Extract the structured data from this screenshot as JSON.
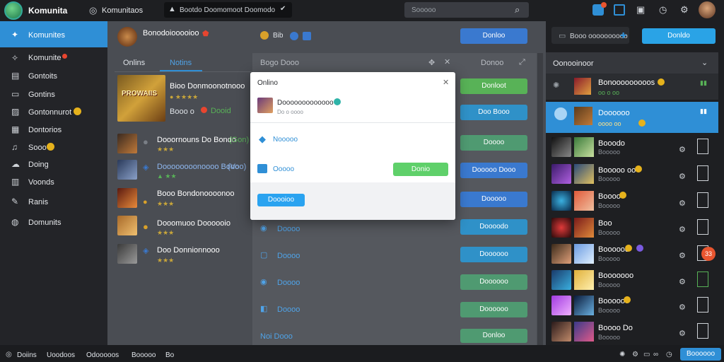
{
  "topbar": {
    "brand": "Komunita",
    "nav_label": "Komunitaos",
    "tab_text": "Bootdo Doomomoot Doomodo",
    "search_placeholder": "Sooooo"
  },
  "sidebar": {
    "items": [
      {
        "label": "Komunites",
        "icon": "globe-icon"
      },
      {
        "label": "Komunite",
        "icon": "star-icon"
      },
      {
        "label": "Gontoits",
        "icon": "grid-icon"
      },
      {
        "label": "Gontins",
        "icon": "chat-icon"
      },
      {
        "label": "Gontonnurot",
        "icon": "image-icon"
      },
      {
        "label": "Dontorios",
        "icon": "chart-icon"
      },
      {
        "label": "Sooo",
        "icon": "music-icon"
      },
      {
        "label": "Doing",
        "icon": "cloud-icon"
      },
      {
        "label": "Voonds",
        "icon": "book-icon"
      },
      {
        "label": "Ranis",
        "icon": "pencil-icon"
      },
      {
        "label": "Domunits",
        "icon": "world-icon"
      }
    ]
  },
  "main": {
    "header_title": "Bonodoiooooioo",
    "header_badge": "Bib",
    "header_button": "Donloo",
    "tabs": [
      "Onlins",
      "Notins"
    ],
    "panel_title": "Bogo Dooo",
    "col_label": "Donoo",
    "featured": {
      "title": "Bioo Donmoonotnooo",
      "sub": "Booo o",
      "tag": "Dooid",
      "logo_text": "PROWAIIS"
    },
    "rows": [
      {
        "title": "Dooornouns Do Bondo",
        "tag": "(Gon)"
      },
      {
        "title": "Doooooooonoooo Bono",
        "tag": "(Voo)"
      },
      {
        "title": "Booo Bondonoooonoo"
      },
      {
        "title": "Dooomuoo Doooooio"
      },
      {
        "title": "Doo Donnionnooo"
      }
    ],
    "right_buttons": [
      "Donloo",
      "Donloot",
      "Doo Booo",
      "Doooo",
      "Dooooo Dooo",
      "Dooooo",
      "Doooodo",
      "Doooooo",
      "Doooooo",
      "Doooooo"
    ],
    "under_modal": [
      {
        "label": "Doooo",
        "icon": "twitter-icon"
      },
      {
        "label": "Doooo",
        "icon": "grid-icon"
      },
      {
        "label": "Doooo",
        "icon": "circle-icon"
      },
      {
        "label": "Doooo",
        "icon": "box-icon"
      },
      {
        "label": "Noi Dooo",
        "icon": ""
      }
    ]
  },
  "modal": {
    "title": "Onlino",
    "user": "Dooooooooooooo",
    "user_sub": "Do o oooo",
    "rows": [
      "Nooooo",
      "Ooooo"
    ],
    "green_btn": "Donio",
    "blue_btn": "Doooioo"
  },
  "right": {
    "search_placeholder": "Booo oooooooooo",
    "top_button": "Donldo",
    "header": "Oonooinoor",
    "items": [
      {
        "title": "Bonooooooooos",
        "sub": "oo o oo"
      },
      {
        "title": "Doooooo",
        "sub": "oooo oo"
      },
      {
        "title": "Booodo",
        "sub": "Booooo"
      },
      {
        "title": "Booooo oo",
        "sub": "Booooo"
      },
      {
        "title": "Boooo",
        "sub": "Booooo"
      },
      {
        "title": "Boo",
        "sub": "Booooo"
      },
      {
        "title": "Boooooo",
        "sub": "Booooo"
      },
      {
        "title": "Booooooo",
        "sub": "Booooo"
      },
      {
        "title": "Boooooo",
        "sub": "Booooo"
      },
      {
        "title": "Boooo Do",
        "sub": "Booooo"
      }
    ],
    "badge": "33"
  },
  "bottom": {
    "items": [
      "Doiins",
      "Uoodoos",
      "Odooooos",
      "Booooo",
      "Bo"
    ],
    "button": "Boooooo"
  },
  "colors": {
    "accent": "#2f8fd6",
    "green": "#58b257",
    "blue": "#3a79cf",
    "bg": "#2b2d31"
  }
}
